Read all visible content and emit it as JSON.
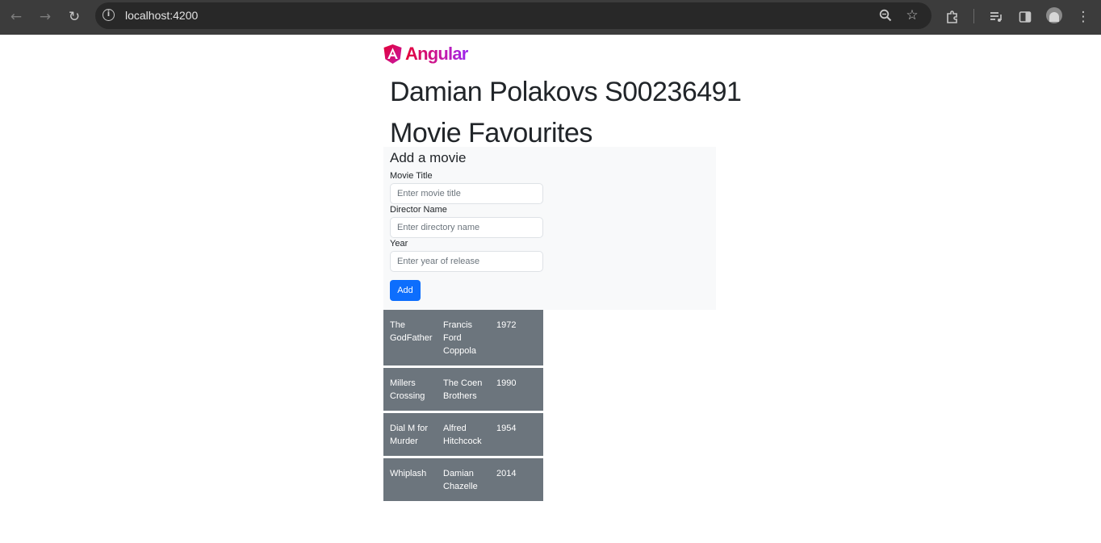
{
  "browser": {
    "url": "localhost:4200",
    "icons": [
      "back-arrow-icon",
      "forward-arrow-icon",
      "reload-icon",
      "site-info-icon",
      "zoom-icon",
      "bookmark-star-icon",
      "extensions-icon",
      "media-controls-icon",
      "side-panel-icon",
      "profile-avatar",
      "more-menu-icon"
    ]
  },
  "page": {
    "logo_text": "Angular",
    "student_heading": "Damian Polakovs S00236491",
    "app_heading": "Movie Favourites"
  },
  "form": {
    "title": "Add a movie",
    "title_label": "Movie Title",
    "title_placeholder": "Enter movie title",
    "director_label": "Director Name",
    "director_placeholder": "Enter directory name",
    "year_label": "Year",
    "year_placeholder": "Enter year of release",
    "add_label": "Add"
  },
  "movies": [
    {
      "title": "The GodFather",
      "director": "Francis Ford Coppola",
      "year": "1972"
    },
    {
      "title": "Millers Crossing",
      "director": "The Coen Brothers",
      "year": "1990"
    },
    {
      "title": "Dial M for Murder",
      "director": "Alfred Hitchcock",
      "year": "1954"
    },
    {
      "title": "Whiplash",
      "director": "Damian Chazelle",
      "year": "2014"
    }
  ],
  "colors": {
    "chrome_bg": "#3c3c3c",
    "primary_button": "#0d6efd",
    "movie_row_bg": "#6c757d",
    "form_panel_bg": "#f8f9fa"
  }
}
